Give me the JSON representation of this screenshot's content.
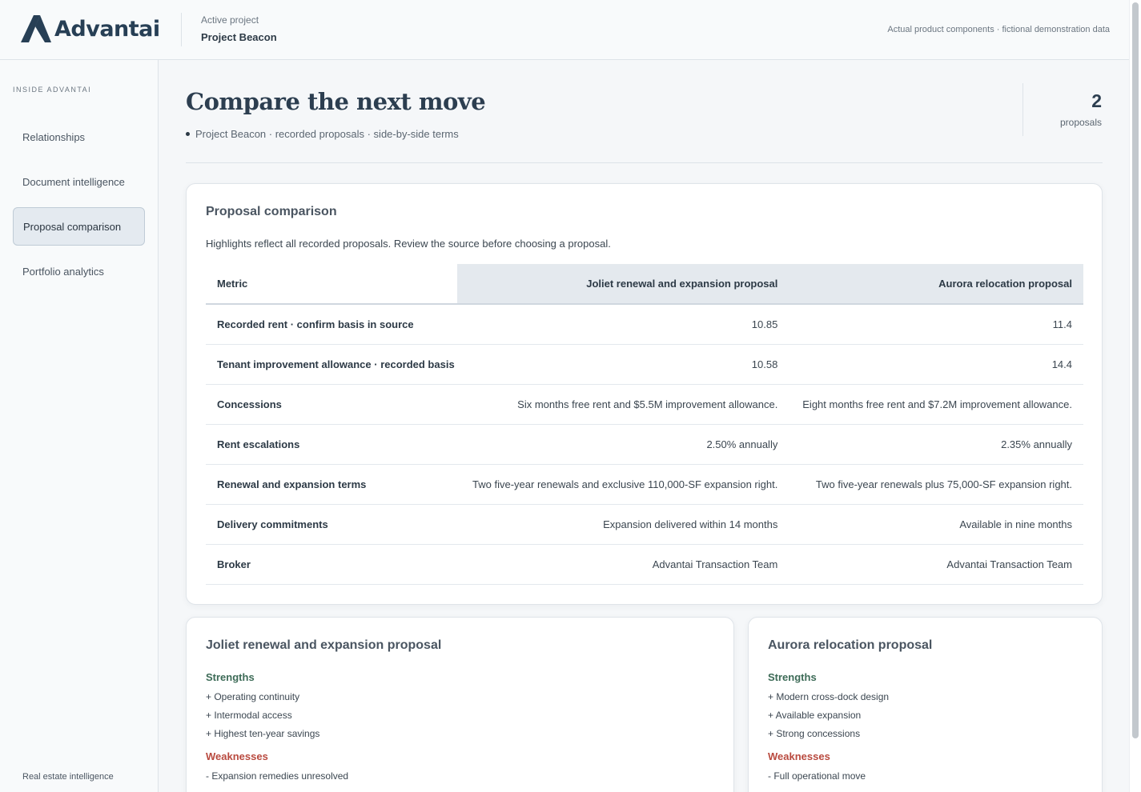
{
  "header": {
    "brand": "Advantai",
    "project_caption": "Active project",
    "project_name": "Project Beacon",
    "disclaimer": "Actual product components · fictional demonstration data"
  },
  "sidebar": {
    "caption": "INSIDE ADVANTAI",
    "items": [
      {
        "label": "Relationships",
        "active": false
      },
      {
        "label": "Document intelligence",
        "active": false
      },
      {
        "label": "Proposal comparison",
        "active": true
      },
      {
        "label": "Portfolio analytics",
        "active": false
      }
    ],
    "footer": "Real estate intelligence"
  },
  "page": {
    "title": "Compare the next move",
    "subtitle": "Project Beacon · recorded proposals · side-by-side terms",
    "stat_value": "2",
    "stat_label": "proposals"
  },
  "comparison": {
    "title": "Proposal comparison",
    "note": "Highlights reflect all recorded proposals. Review the source before choosing a proposal.",
    "columns": [
      "Metric",
      "Joliet renewal and expansion proposal",
      "Aurora relocation proposal"
    ],
    "rows": [
      [
        "Recorded rent · confirm basis in source",
        "10.85",
        "11.4"
      ],
      [
        "Tenant improvement allowance · recorded basis",
        "10.58",
        "14.4"
      ],
      [
        "Concessions",
        "Six months free rent and $5.5M improvement allowance.",
        "Eight months free rent and $7.2M improvement allowance."
      ],
      [
        "Rent escalations",
        "2.50% annually",
        "2.35% annually"
      ],
      [
        "Renewal and expansion terms",
        "Two five-year renewals and exclusive 110,000-SF expansion right.",
        "Two five-year renewals plus 75,000-SF expansion right."
      ],
      [
        "Delivery commitments",
        "Expansion delivered within 14 months",
        "Available in nine months"
      ],
      [
        "Broker",
        "Advantai Transaction Team",
        "Advantai Transaction Team"
      ]
    ]
  },
  "proposals": [
    {
      "title": "Joliet renewal and expansion proposal",
      "strengths_label": "Strengths",
      "strengths": [
        "+ Operating continuity",
        "+ Intermodal access",
        "+ Highest ten-year savings"
      ],
      "weaknesses_label": "Weaknesses",
      "weaknesses": [
        "- Expansion remedies unresolved"
      ]
    },
    {
      "title": "Aurora relocation proposal",
      "strengths_label": "Strengths",
      "strengths": [
        "+ Modern cross-dock design",
        "+ Available expansion",
        "+ Strong concessions"
      ],
      "weaknesses_label": "Weaknesses",
      "weaknesses": [
        "- Full operational move"
      ]
    }
  ],
  "colors": {
    "brand": "#273f55",
    "active_nav_bg": "#e4eaf0",
    "strength": "#3d6b57",
    "weakness": "#b94a3f"
  }
}
